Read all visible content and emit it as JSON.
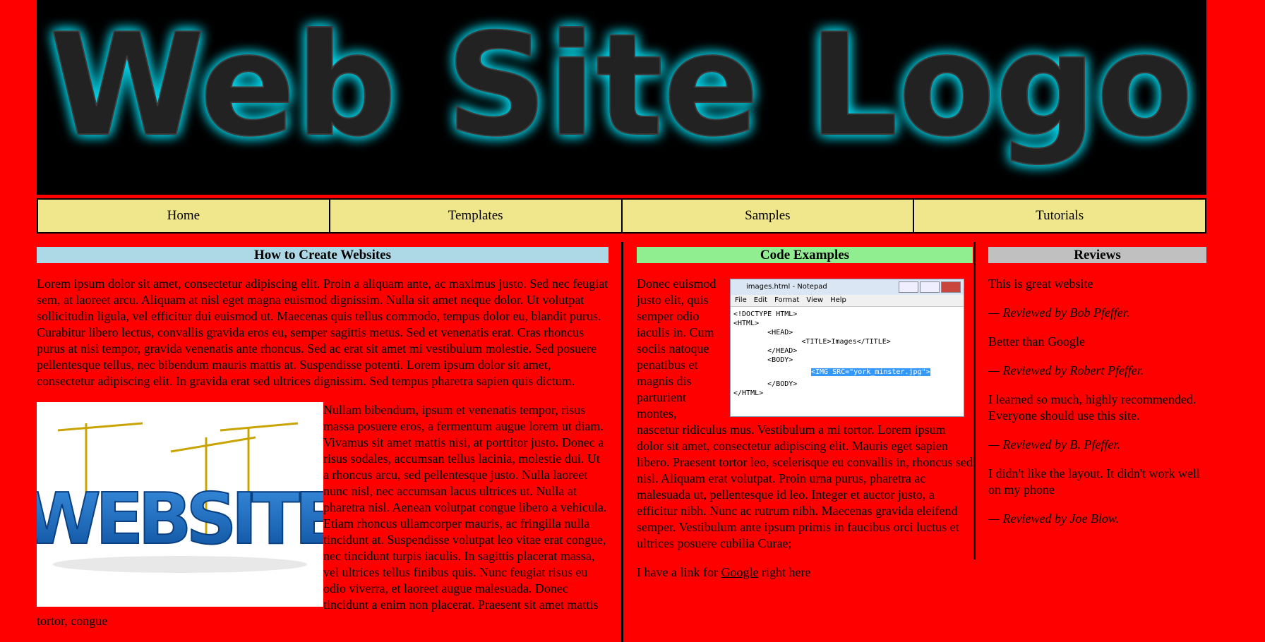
{
  "logo": {
    "text": "Web Site Logo",
    "glow_color": "#00d4e8",
    "text_color": "#222222"
  },
  "nav": {
    "items": [
      {
        "label": "Home"
      },
      {
        "label": "Templates"
      },
      {
        "label": "Samples"
      },
      {
        "label": "Tutorials"
      }
    ]
  },
  "col1": {
    "heading": "How to Create Websites",
    "heading_bg": "#add8e6",
    "para1": "Lorem ipsum dolor sit amet, consectetur adipiscing elit. Proin a aliquam ante, ac maximus justo. Sed nec feugiat sem, at laoreet arcu. Aliquam at nisl eget magna euismod dignissim. Nulla sit amet neque dolor. Ut volutpat sollicitudin ligula, vel efficitur dui euismod ut. Maecenas quis tellus commodo, tempus dolor eu, blandit purus. Curabitur libero lectus, convallis gravida eros eu, semper sagittis metus. Sed et venenatis erat. Cras rhoncus purus at nisi tempor, gravida venenatis ante rhoncus. Sed ac erat sit amet mi vestibulum molestie. Sed posuere pellentesque tellus, nec bibendum mauris mattis at. Suspendisse potenti. Lorem ipsum dolor sit amet, consectetur adipiscing elit. In gravida erat sed ultrices dignissim. Sed tempus pharetra sapien quis dictum.",
    "image_text": "WEBSITE",
    "para2": "Nullam bibendum, ipsum et venenatis tempor, risus massa posuere eros, a fermentum augue lorem ut diam. Vivamus sit amet mattis nisi, at porttitor justo. Donec a risus sodales, accumsan tellus lacinia, molestie dui. Ut a rhoncus arcu, sed pellentesque justo. Nulla laoreet nunc nisl, nec accumsan lacus ultrices ut. Nulla at pharetra nisl. Aenean volutpat congue libero a vehicula. Etiam rhoncus ullamcorper mauris, ac fringilla nulla tincidunt at. Suspendisse volutpat leo vitae erat congue, nec tincidunt turpis iaculis. In sagittis placerat massa, vel ultrices tellus finibus quis. Nunc feugiat risus eu odio viverra, et laoreet augue malesuada. Donec tincidunt a enim non placerat. Praesent sit amet mattis tortor, congue"
  },
  "col2": {
    "heading": "Code Examples",
    "heading_bg": "#90ee90",
    "notepad": {
      "title": "images.html - Notepad",
      "menu": [
        "File",
        "Edit",
        "Format",
        "View",
        "Help"
      ],
      "line1": "<!DOCTYPE HTML>",
      "line2": "<HTML>",
      "line3": "        <HEAD>",
      "line4": "                <TITLE>Images</TITLE>",
      "line5": "        </HEAD>",
      "line6": "        <BODY>",
      "line7": "<IMG SRC=\"york_minster.jpg\">",
      "line8": "        </BODY>",
      "line9": "</HTML>"
    },
    "para1": "Donec euismod justo elit, quis semper odio iaculis in. Cum sociis natoque penatibus et magnis dis parturient montes, nascetur ridiculus mus. Vestibulum a mi tortor. Lorem ipsum dolor sit amet, consectetur adipiscing elit. Mauris eget sapien libero. Praesent tortor leo, scelerisque eu convallis in, rhoncus sed nisl. Aliquam erat volutpat. Proin urna purus, pharetra ac malesuada ut, pellentesque id leo. Integer et auctor justo, a efficitur nibh. Nunc ac rutrum nibh. Maecenas gravida eleifend semper. Vestibulum ante ipsum primis in faucibus orci luctus et ultrices posuere cubilia Curae;",
    "link_pre": "I have a link for ",
    "link_text": "Google",
    "link_post": " right here"
  },
  "col3": {
    "heading": "Reviews",
    "heading_bg": "#c0c0c0",
    "reviews": [
      {
        "text": "This is great website",
        "author": "— Reviewed by Bob Pfeffer."
      },
      {
        "text": "Better than Google",
        "author": "— Reviewed by Robert Pfeffer."
      },
      {
        "text": "I learned so much, highly recommended. Everyone should use this site.",
        "author": "— Reviewed by B. Pfeffer."
      },
      {
        "text": "I didn't like the layout. It didn't work well on my phone",
        "author": "— Reviewed by Joe Blow."
      }
    ]
  }
}
